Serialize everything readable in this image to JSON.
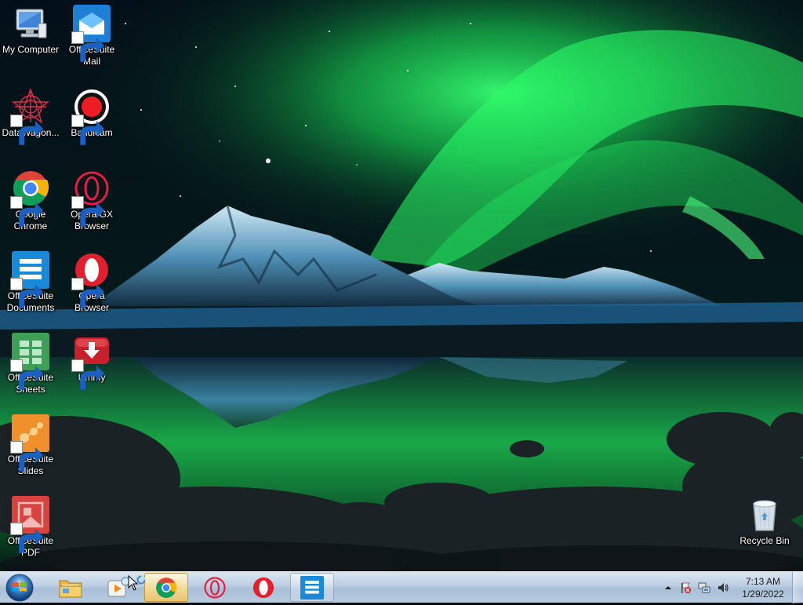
{
  "desktop": {
    "icons": [
      {
        "id": "my-computer",
        "label": "My Computer",
        "icon": "computer-icon",
        "shortcut": false
      },
      {
        "id": "officesuite-mail",
        "label": "OfficeSuite\nMail",
        "icon": "officesuite-mail-icon",
        "shortcut": true
      },
      {
        "id": "datawagon",
        "label": "DataWagon...",
        "icon": "datawagon-icon",
        "shortcut": true
      },
      {
        "id": "bandicam",
        "label": "Bandicam",
        "icon": "bandicam-icon",
        "shortcut": true
      },
      {
        "id": "google-chrome",
        "label": "Google\nChrome",
        "icon": "chrome-icon",
        "shortcut": true
      },
      {
        "id": "opera-gx",
        "label": "Opera GX\nBrowser",
        "icon": "opera-gx-icon",
        "shortcut": true
      },
      {
        "id": "officesuite-documents",
        "label": "OfficeSuite\nDocuments",
        "icon": "officesuite-documents-icon",
        "shortcut": true
      },
      {
        "id": "opera-browser",
        "label": "Opera\nBrowser",
        "icon": "opera-icon",
        "shortcut": true
      },
      {
        "id": "officesuite-sheets",
        "label": "OfficeSuite\nSheets",
        "icon": "officesuite-sheets-icon",
        "shortcut": true
      },
      {
        "id": "ummy",
        "label": "Ummy",
        "icon": "ummy-icon",
        "shortcut": true
      },
      {
        "id": "officesuite-slides",
        "label": "OfficeSuite\nSlides",
        "icon": "officesuite-slides-icon",
        "shortcut": true
      },
      {
        "id": "officesuite-pdf",
        "label": "OfficeSuite\nPDF",
        "icon": "officesuite-pdf-icon",
        "shortcut": true
      },
      {
        "id": "recycle-bin",
        "label": "Recycle Bin",
        "icon": "recycle-bin-icon",
        "shortcut": false
      }
    ]
  },
  "taskbar": {
    "start_icon": "windows-start-orb-icon",
    "pinned": [
      {
        "id": "file-explorer",
        "icon": "folder-icon",
        "state": "normal"
      },
      {
        "id": "media-player",
        "icon": "media-player-icon",
        "state": "normal"
      },
      {
        "id": "chrome",
        "icon": "chrome-icon",
        "state": "active"
      },
      {
        "id": "opera-gx",
        "icon": "opera-gx-icon",
        "state": "normal"
      },
      {
        "id": "opera",
        "icon": "opera-icon",
        "state": "normal"
      },
      {
        "id": "officesuite",
        "icon": "officesuite-documents-icon",
        "state": "running"
      }
    ],
    "tray": {
      "icons": [
        "show-hidden-icons-chevron",
        "action-center-flag-icon",
        "network-icon",
        "volume-icon"
      ],
      "time": "7:13 AM",
      "date": "1/29/2022"
    }
  },
  "colors": {
    "aurora": "#2bff6a",
    "taskbar_top": "#dbe6f2",
    "taskbar_bottom": "#a9bfd8",
    "officesuite_blue": "#1e7fd0",
    "opera_red": "#e0202e",
    "sheets_green": "#3f9e57",
    "slides_orange": "#f0902c",
    "pdf_red": "#d8423f"
  }
}
